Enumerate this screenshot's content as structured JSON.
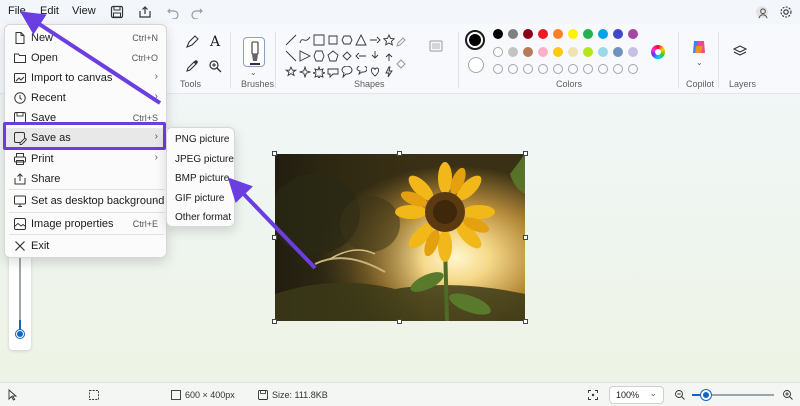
{
  "menubar": {
    "file": "File",
    "edit": "Edit",
    "view": "View"
  },
  "ribbon": {
    "tools_label": "Tools",
    "brushes_label": "Brushes",
    "shapes_label": "Shapes",
    "colors_label": "Colors",
    "copilot_label": "Copilot",
    "layers_label": "Layers",
    "text_tool": "A",
    "palette_row1": [
      "#000000",
      "#7f7f7f",
      "#880015",
      "#ed1c24",
      "#ff7f27",
      "#fff200",
      "#22b14c",
      "#00a2e8",
      "#3f48cc",
      "#a349a4"
    ],
    "palette_row2": [
      "#ffffff",
      "#c3c3c3",
      "#b97a57",
      "#ffaec9",
      "#ffc90e",
      "#efe4b0",
      "#b5e61d",
      "#99d9ea",
      "#7092be",
      "#c8bfe7"
    ],
    "primary_color": "#000000",
    "secondary_color": "#ffffff"
  },
  "file_menu": {
    "items": [
      {
        "label": "New",
        "key": "Ctrl+N"
      },
      {
        "label": "Open",
        "key": "Ctrl+O"
      },
      {
        "label": "Import to canvas",
        "key": ""
      },
      {
        "label": "Recent",
        "key": ""
      },
      {
        "label": "Save",
        "key": "Ctrl+S"
      },
      {
        "label": "Save as",
        "key": ""
      },
      {
        "label": "Print",
        "key": ""
      },
      {
        "label": "Share",
        "key": ""
      },
      {
        "label": "Set as desktop background",
        "key": ""
      },
      {
        "label": "Image properties",
        "key": "Ctrl+E"
      },
      {
        "label": "Exit",
        "key": ""
      }
    ]
  },
  "save_as_menu": {
    "items": [
      "PNG picture",
      "JPEG picture",
      "BMP picture",
      "GIF picture",
      "Other format"
    ]
  },
  "status": {
    "canvas_size": "600 × 400px",
    "file_size": "Size: 111.8KB",
    "zoom": "100%"
  },
  "colors": {
    "accent": "#6a3ee0",
    "zoom_thumb": "#1565c0"
  }
}
